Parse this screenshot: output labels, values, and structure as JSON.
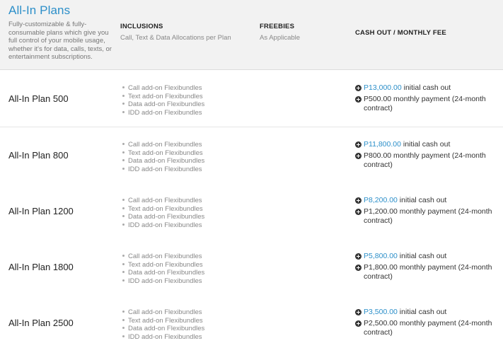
{
  "header": {
    "title": "All-In Plans",
    "description": "Fully-customizable & fully-consumable plans which give you full control of your mobile usage, whether it's for data, calls, texts, or entertainment subscriptions.",
    "columns": [
      {
        "heading": "INCLUSIONS",
        "subheading": "Call, Text & Data Allocations per Plan"
      },
      {
        "heading": "FREEBIES",
        "subheading": "As Applicable"
      },
      {
        "heading": "CASH OUT / MONTHLY FEE",
        "subheading": ""
      }
    ]
  },
  "plans": [
    {
      "name": "All-In Plan 500",
      "inclusions": [
        "Call add-on Flexibundles",
        "Text add-on Flexibundles",
        "Data add-on Flexibundles",
        "IDD add-on Flexibundles"
      ],
      "cash_out_price": "P13,000.00",
      "cash_out_suffix": " initial cash out",
      "monthly": "P500.00 monthly payment (24-month contract)"
    },
    {
      "name": "All-In Plan 800",
      "inclusions": [
        "Call add-on Flexibundles",
        "Text add-on Flexibundles",
        "Data add-on Flexibundles",
        "IDD add-on Flexibundles"
      ],
      "cash_out_price": "P11,800.00",
      "cash_out_suffix": " initial cash out",
      "monthly": "P800.00 monthly payment (24-month contract)"
    },
    {
      "name": "All-In Plan 1200",
      "inclusions": [
        "Call add-on Flexibundles",
        "Text add-on Flexibundles",
        "Data add-on Flexibundles",
        "IDD add-on Flexibundles"
      ],
      "cash_out_price": "P8,200.00",
      "cash_out_suffix": " initial cash out",
      "monthly": "P1,200.00 monthly payment (24-month contract)"
    },
    {
      "name": "All-In Plan 1800",
      "inclusions": [
        "Call add-on Flexibundles",
        "Text add-on Flexibundles",
        "Data add-on Flexibundles",
        "IDD add-on Flexibundles"
      ],
      "cash_out_price": "P5,800.00",
      "cash_out_suffix": " initial cash out",
      "monthly": "P1,800.00 monthly payment (24-month contract)"
    },
    {
      "name": "All-In Plan 2500",
      "inclusions": [
        "Call add-on Flexibundles",
        "Text add-on Flexibundles",
        "Data add-on Flexibundles",
        "IDD add-on Flexibundles"
      ],
      "cash_out_price": "P3,500.00",
      "cash_out_suffix": " initial cash out",
      "monthly": "P2,500.00 monthly payment (24-month contract)"
    }
  ],
  "colors": {
    "accent": "#2c8fc9",
    "header_bg": "#f2f2f2",
    "muted_text": "#888888"
  },
  "icons": {
    "bullet": "bullet-dot-icon",
    "fee_marker": "plus-circle-icon"
  }
}
